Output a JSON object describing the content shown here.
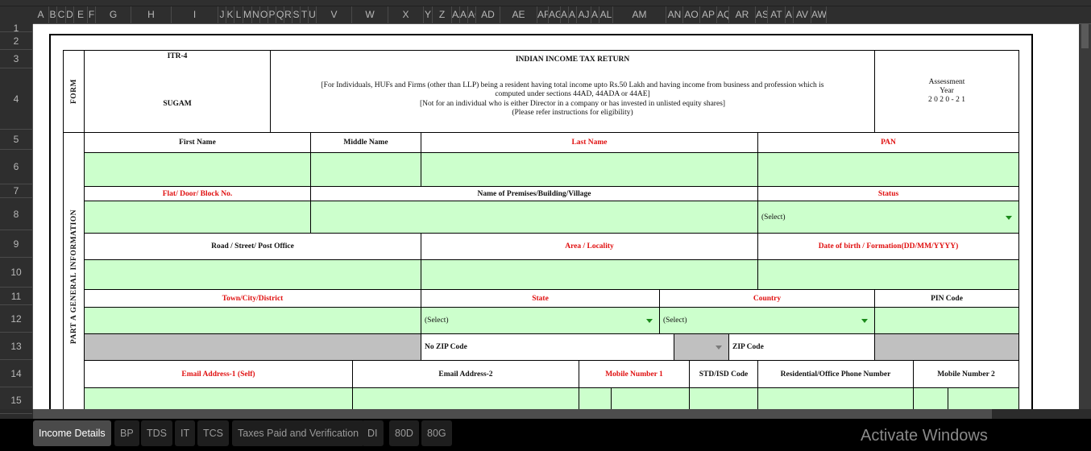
{
  "columns": [
    "A",
    "B",
    "C",
    "D",
    "E",
    "F",
    "G",
    "H",
    "I",
    "J",
    "K",
    "L",
    "M",
    "N",
    "O",
    "P",
    "Q",
    "R",
    "S",
    "T",
    "U",
    "V",
    "W",
    "X",
    "Y",
    "Z",
    "AA",
    "AB",
    "AC",
    "AD",
    "AE",
    "AF",
    "AG",
    "AH",
    "AI",
    "AJ",
    "AK",
    "AL",
    "AM",
    "AN",
    "AO",
    "AP",
    "AQ",
    "AR",
    "AS",
    "AT",
    "AU",
    "AV",
    "AW"
  ],
  "rows": [
    "1",
    "2",
    "3",
    "4",
    "5",
    "6",
    "7",
    "8",
    "9",
    "10",
    "11",
    "12",
    "13",
    "14",
    "15"
  ],
  "form": {
    "form_label": "FORM",
    "form_number": "ITR-4",
    "form_name": "SUGAM",
    "title": "INDIAN INCOME TAX RETURN",
    "description_line1": "[For Individuals, HUFs and Firms (other than LLP) being a resident having total income upto Rs.50 Lakh and having income from business and profession which is",
    "description_line2": "computed under sections 44AD, 44ADA or 44AE]",
    "description_line3": "[Not for an individual who is either Director in a company or has invested in unlisted equity shares]",
    "description_line4": "(Please refer instructions for eligibility)",
    "assessment_label1": "Assessment",
    "assessment_label2": "Year",
    "assessment_year": "2 0 2 0 - 2 1",
    "section_label": "PART A GENERAL INFORMATION"
  },
  "fields": {
    "first_name": "First Name",
    "middle_name": "Middle Name",
    "last_name": "Last Name",
    "pan": "PAN",
    "flat": "Flat/ Door/ Block No.",
    "premises": "Name of Premises/Building/Village",
    "status": "Status",
    "road": "Road / Street/ Post Office",
    "area": "Area / Locality",
    "dob": "Date of birth / Formation(DD/MM/YYYY)",
    "town": "Town/City/District",
    "state": "State",
    "country": "Country",
    "pin": "PIN Code",
    "no_zip": "No ZIP Code",
    "zip": "ZIP Code",
    "email1": "Email Address-1 (Self)",
    "email2": "Email Address-2",
    "mobile1": "Mobile Number 1",
    "std": "STD/ISD Code",
    "phone": "Residential/Office Phone Number",
    "mobile2": "Mobile Number 2"
  },
  "selects": {
    "status_value": "(Select)",
    "state_value": "(Select)",
    "country_value": "(Select)"
  },
  "tabs": [
    {
      "label": "Income Details",
      "active": true
    },
    {
      "label": "BP"
    },
    {
      "label": "TDS"
    },
    {
      "label": "IT"
    },
    {
      "label": "TCS"
    },
    {
      "label": "Taxes Paid and Verification"
    },
    {
      "label": "DI"
    },
    {
      "label": "80D"
    },
    {
      "label": "80G"
    }
  ],
  "watermark": "Activate Windows",
  "colors": {
    "input_green": "#ccffcc",
    "required_red": "#e01010",
    "disabled_gray": "#c0c0c0",
    "dropdown_arrow": "#1a8a1a"
  }
}
